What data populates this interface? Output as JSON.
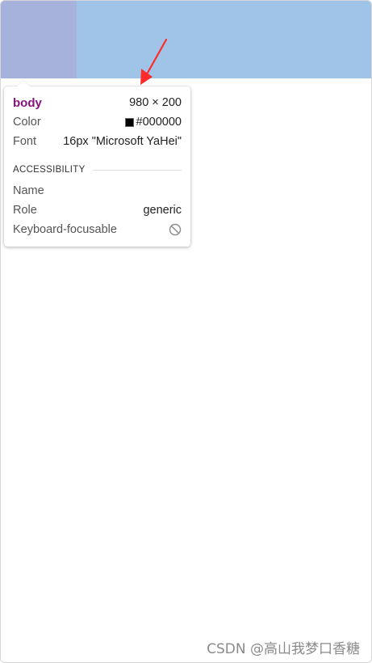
{
  "inspector": {
    "tag": "body",
    "dimensions": "980 × 200",
    "color_label": "Color",
    "color_value": "#000000",
    "font_label": "Font",
    "font_value": "16px \"Microsoft YaHei\"",
    "accessibility_header": "ACCESSIBILITY",
    "name_label": "Name",
    "name_value": "",
    "role_label": "Role",
    "role_value": "generic",
    "focusable_label": "Keyboard-focusable",
    "focusable_icon": "not-allowed-icon"
  },
  "colors": {
    "page_band": "#a0c4e8",
    "element_highlight": "#a6b2dc",
    "arrow": "#ff2a2a",
    "tag_name": "#881280",
    "swatch": "#000000"
  },
  "watermark": "CSDN @高山我梦口香糖"
}
